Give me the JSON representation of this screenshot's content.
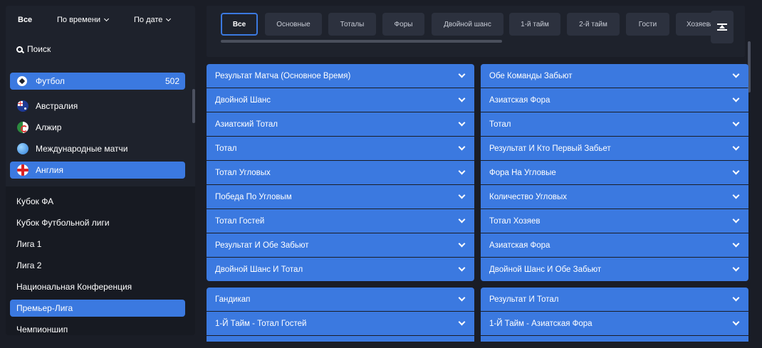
{
  "sidebar": {
    "filters": {
      "all": "Все",
      "by_time": "По времени",
      "by_date": "По дате"
    },
    "search_label": "Поиск",
    "sport": {
      "name": "Футбол",
      "count": "502",
      "icon": "football-icon"
    },
    "countries": [
      {
        "name": "Австралия",
        "flag": "australia-flag-icon"
      },
      {
        "name": "Алжир",
        "flag": "algeria-flag-icon"
      },
      {
        "name": "Международные матчи",
        "flag": "globe-icon"
      },
      {
        "name": "Англия",
        "flag": "england-flag-icon"
      }
    ],
    "leagues": [
      {
        "name": "Кубок ФА"
      },
      {
        "name": "Кубок Футбольной лиги"
      },
      {
        "name": "Лига 1"
      },
      {
        "name": "Лига 2"
      },
      {
        "name": "Национальная Конференция"
      },
      {
        "name": "Премьер-Лига"
      },
      {
        "name": "Чемпионшип"
      }
    ]
  },
  "tabs": [
    "Все",
    "Основные",
    "Тоталы",
    "Форы",
    "Двойной шанс",
    "1-й тайм",
    "2-й тайм",
    "Гости",
    "Хозяева"
  ],
  "markets_left": [
    "Результат Матча (Основное Время)",
    "Двойной Шанс",
    "Азиатский Тотал",
    "Тотал",
    "Тотал Угловых",
    "Победа По Угловым",
    "Тотал Гостей",
    "Результат И Обе Забьют",
    "Двойной Шанс И Тотал"
  ],
  "markets_right": [
    "Обе Команды Забьют",
    "Азиатская Фора",
    "Тотал",
    "Результат И Кто Первый Забьет",
    "Фора На Угловые",
    "Количество Угловых",
    "Тотал Хозяев",
    "Азиатская Фора",
    "Двойной Шанс И Обе Забьют"
  ],
  "markets_left_2": [
    "Гандикап",
    "1-Й Тайм - Тотал Гостей"
  ],
  "markets_right_2": [
    "Результат И Тотал",
    "1-Й Тайм - Азиатская Фора"
  ],
  "colors": {
    "accent": "#3b79e0",
    "background": "#1a1d26",
    "panel": "#1e222c"
  }
}
